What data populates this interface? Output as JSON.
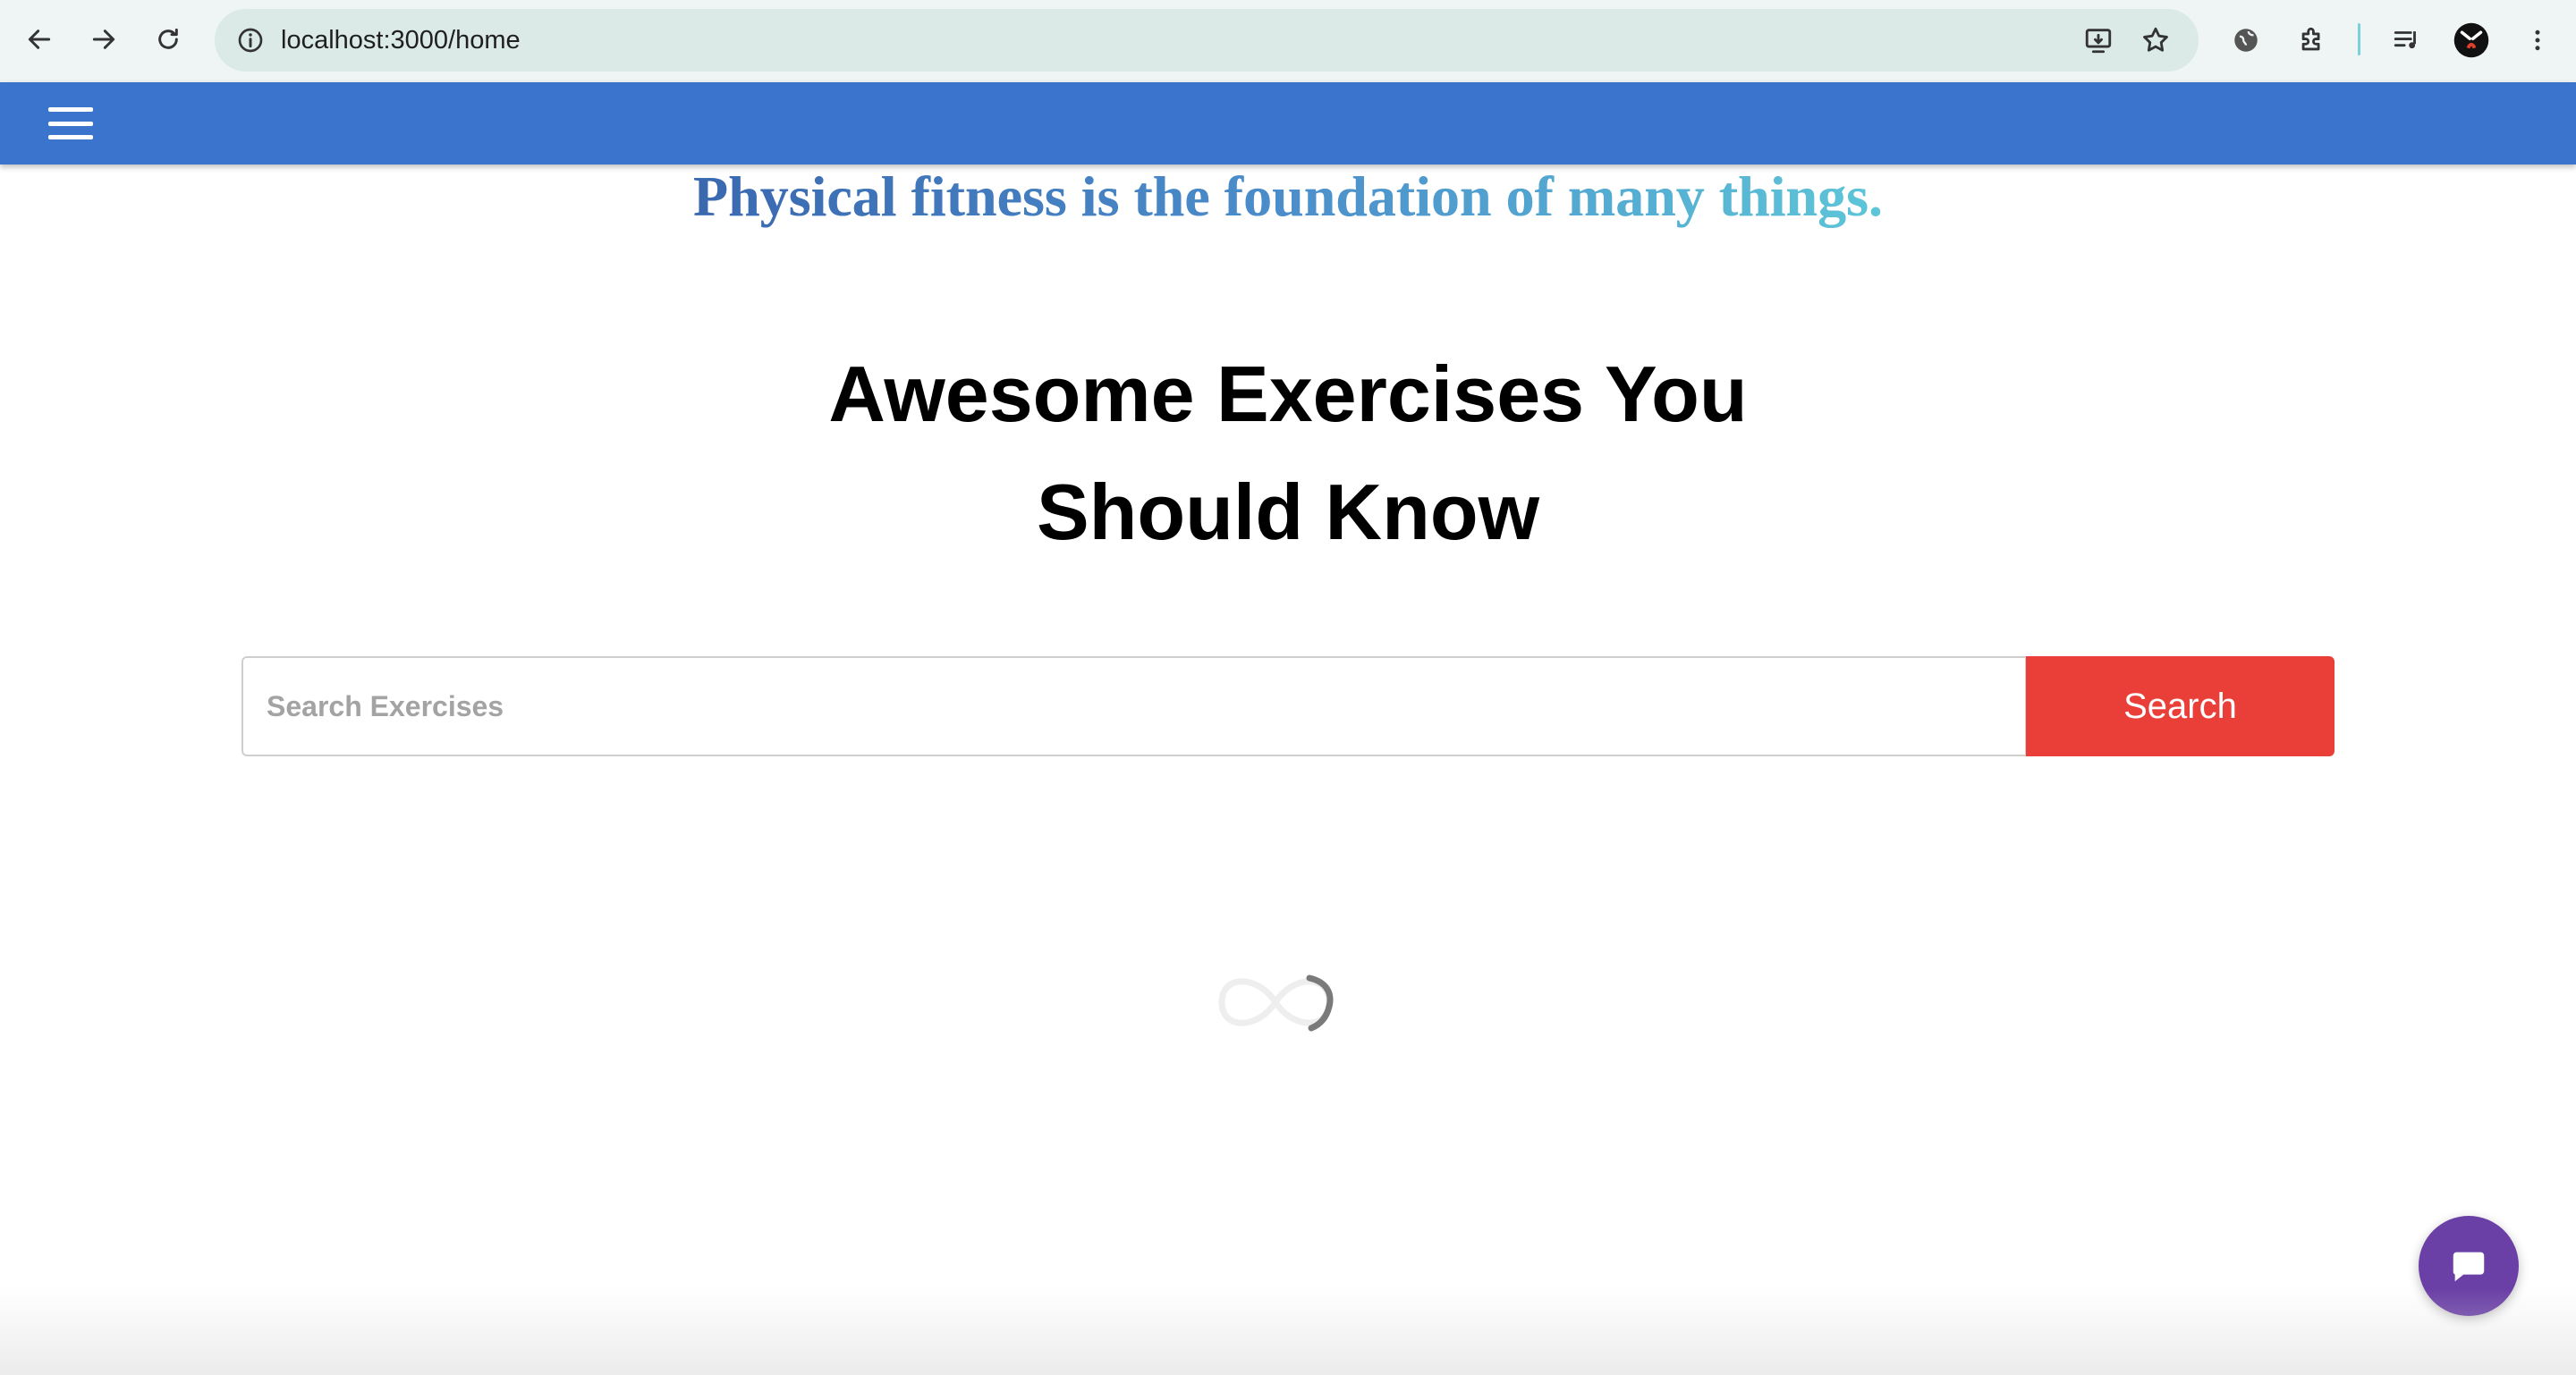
{
  "browser": {
    "url": "localhost:3000/home",
    "icons": [
      "back-arrow-icon",
      "forward-arrow-icon",
      "reload-icon",
      "site-info-icon",
      "install-app-icon",
      "bookmark-star-icon",
      "extension-globe-icon",
      "extensions-puzzle-icon",
      "media-control-icon",
      "profile-avatar-icon",
      "more-options-icon"
    ]
  },
  "header": {
    "menu_icon": "hamburger-menu-icon",
    "background": "#3a74cc"
  },
  "main": {
    "tagline": "Physical fitness is the foundation of many things.",
    "title_line1": "Awesome Exercises You",
    "title_line2": "Should Know",
    "search": {
      "placeholder": "Search Exercises",
      "value": "",
      "button_label": "Search",
      "button_color": "#ea3f38"
    }
  },
  "loader": {
    "icon": "infinity-loader-icon"
  },
  "chat": {
    "icon": "chat-bubble-icon",
    "color": "#6a3fa6"
  }
}
